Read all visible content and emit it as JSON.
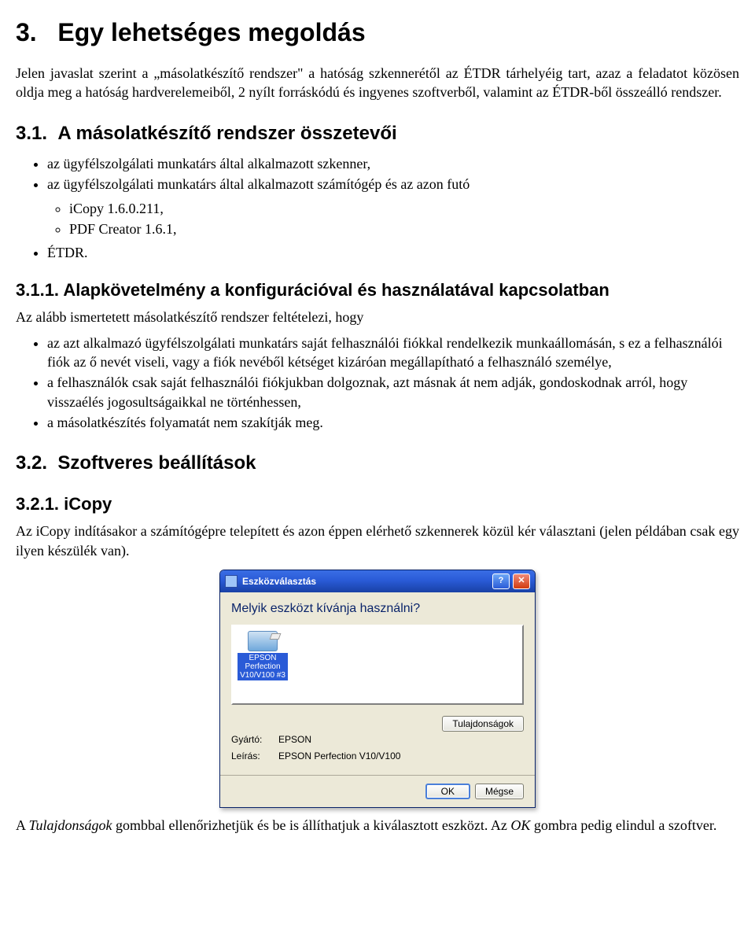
{
  "h1": "3.   Egy lehetséges megoldás",
  "p1": "Jelen javaslat szerint a „másolatkészítő rendszer\" a hatóság szkennerétől az ÉTDR tárhelyéig tart, azaz a feladatot közösen oldja meg a hatóság hardverelemeiből, 2 nyílt forráskódú és ingyenes szoftverből, valamint az ÉTDR-ből összeálló rendszer.",
  "h2_31": "3.1.  A másolatkészítő rendszer összetevői",
  "list31": {
    "i1": "az ügyfélszolgálati munkatárs által alkalmazott szkenner,",
    "i2": "az ügyfélszolgálati munkatárs által alkalmazott számítógép és az azon futó",
    "i2a": "iCopy 1.6.0.211,",
    "i2b": "PDF Creator 1.6.1,",
    "i3": "ÉTDR."
  },
  "h3_311": "3.1.1. Alapkövetelmény a konfigurációval és használatával kapcsolatban",
  "p311": "Az alább ismertetett másolatkészítő rendszer feltételezi, hogy",
  "list311": {
    "i1": "az azt alkalmazó ügyfélszolgálati munkatárs saját felhasználói fiókkal rendelkezik munkaállomásán, s ez a felhasználói fiók az ő nevét viseli, vagy a fiók nevéből kétséget kizáróan megállapítható a felhasználó személye,",
    "i2": "a felhasználók csak saját felhasználói fiókjukban dolgoznak, azt másnak át nem adják, gondoskodnak arról, hogy visszaélés jogosultságaikkal ne történhessen,",
    "i3": "a másolatkészítés folyamatát nem szakítják meg."
  },
  "h2_32": "3.2.  Szoftveres beállítások",
  "h3_321": "3.2.1. iCopy",
  "p321": "Az iCopy indításakor a számítógépre telepített és azon éppen elérhető szkennerek közül kér választani (jelen példában csak egy ilyen készülék van).",
  "dialog": {
    "title": "Eszközválasztás",
    "heading": "Melyik eszközt kívánja használni?",
    "device_label": "EPSON Perfection V10/V100 #3",
    "gyarto_label": "Gyártó:",
    "gyarto_value": "EPSON",
    "leiras_label": "Leírás:",
    "leiras_value": "EPSON Perfection V10/V100",
    "props_btn": "Tulajdonságok",
    "ok_btn": "OK",
    "cancel_btn": "Mégse"
  },
  "p_last_a": "A ",
  "p_last_b": "Tulajdonságok",
  "p_last_c": " gombbal ellenőrizhetjük és be is állíthatjuk a kiválasztott eszközt. Az ",
  "p_last_d": "OK",
  "p_last_e": " gombra pedig elindul a szoftver."
}
